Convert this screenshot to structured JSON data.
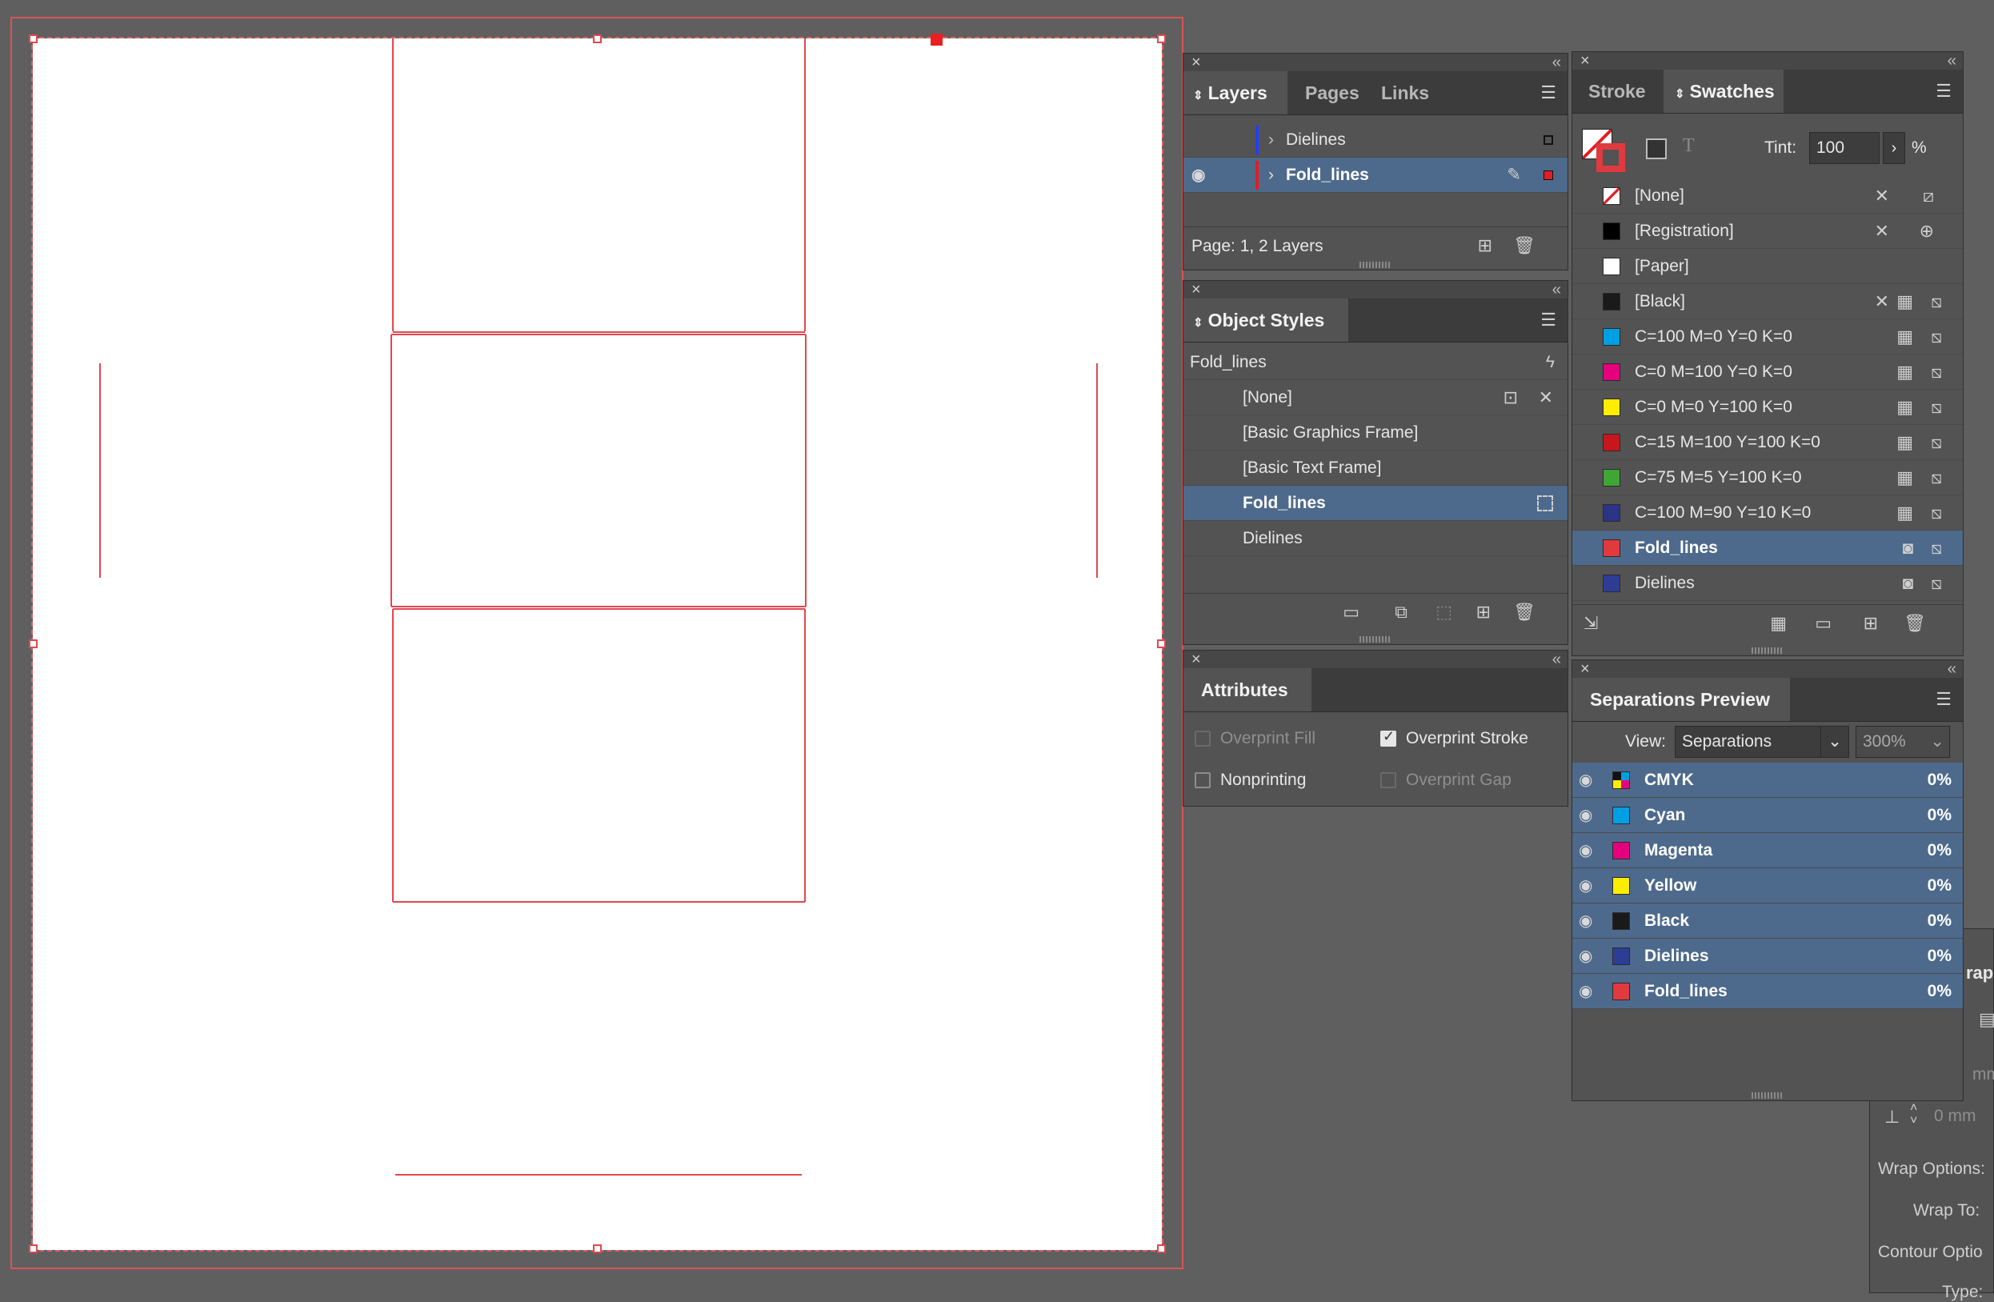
{
  "layers_panel": {
    "tabs": [
      "Layers",
      "Pages",
      "Links"
    ],
    "layers": [
      {
        "name": "Dielines",
        "color": "#1f3fff"
      },
      {
        "name": "Fold_lines",
        "color": "#e21d24"
      }
    ],
    "footer": "Page: 1, 2 Layers"
  },
  "object_styles_panel": {
    "title": "Object Styles",
    "current": "Fold_lines",
    "items": [
      "[None]",
      "[Basic Graphics Frame]",
      "[Basic Text Frame]",
      "Fold_lines",
      "Dielines"
    ]
  },
  "attributes_panel": {
    "title": "Attributes",
    "overprint_fill": "Overprint Fill",
    "overprint_stroke": "Overprint Stroke",
    "nonprinting": "Nonprinting",
    "overprint_gap": "Overprint Gap"
  },
  "swatches_panel": {
    "tabs": [
      "Stroke",
      "Swatches"
    ],
    "tint_label": "Tint:",
    "tint_value": "100",
    "tint_unit": "%",
    "swatches": [
      {
        "name": "[None]",
        "color": "none"
      },
      {
        "name": "[Registration]",
        "color": "#000000"
      },
      {
        "name": "[Paper]",
        "color": "#ffffff"
      },
      {
        "name": "[Black]",
        "color": "#1a1a1a"
      },
      {
        "name": "C=100 M=0 Y=0 K=0",
        "color": "#009fe3"
      },
      {
        "name": "C=0 M=100 Y=0 K=0",
        "color": "#e5007e"
      },
      {
        "name": "C=0 M=0 Y=100 K=0",
        "color": "#ffed00"
      },
      {
        "name": "C=15 M=100 Y=100 K=0",
        "color": "#c9161d"
      },
      {
        "name": "C=75 M=5 Y=100 K=0",
        "color": "#3fa535"
      },
      {
        "name": "C=100 M=90 Y=10 K=0",
        "color": "#2a3586"
      },
      {
        "name": "Fold_lines",
        "color": "#e03a3e"
      },
      {
        "name": "Dielines",
        "color": "#2e3d94"
      }
    ]
  },
  "separations_panel": {
    "title": "Separations Preview",
    "view_label": "View:",
    "view_value": "Separations",
    "zoom_value": "300%",
    "plates": [
      {
        "name": "CMYK",
        "value": "0%",
        "color": "cmyk"
      },
      {
        "name": "Cyan",
        "value": "0%",
        "color": "#009fe3"
      },
      {
        "name": "Magenta",
        "value": "0%",
        "color": "#e5007e"
      },
      {
        "name": "Yellow",
        "value": "0%",
        "color": "#ffed00"
      },
      {
        "name": "Black",
        "value": "0%",
        "color": "#1a1a1a"
      },
      {
        "name": "Dielines",
        "value": "0%",
        "color": "#2e3d94"
      },
      {
        "name": "Fold_lines",
        "value": "0%",
        "color": "#e03a3e"
      }
    ]
  },
  "text_wrap_panel": {
    "title_fragment": "rap",
    "offset_value": "0 mm",
    "unit_fragment": "mm",
    "wrap_options": "Wrap Options:",
    "wrap_to": "Wrap To:",
    "contour_options": "Contour Optio",
    "type_fragment": "Type:"
  }
}
